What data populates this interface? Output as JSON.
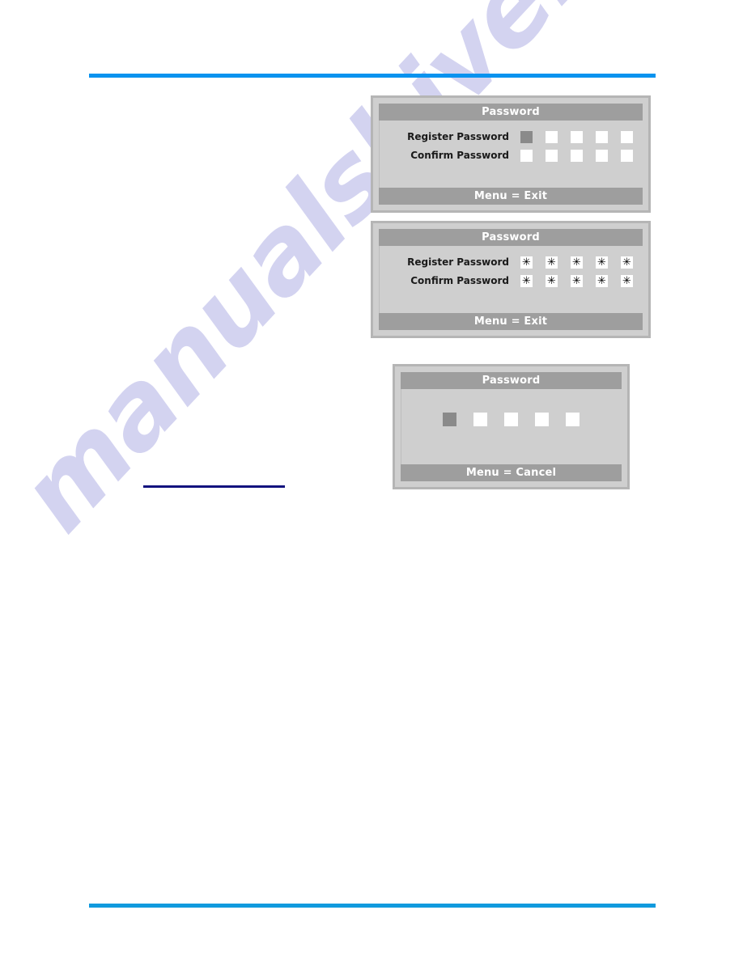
{
  "page": {
    "background": "#ffffff",
    "rule_color_top": "#0a93ef",
    "rule_color_bottom": "#119ade",
    "nav_underline_color": "#12127e"
  },
  "watermark": {
    "text": "manualshive.com",
    "color": "#b9b9e8"
  },
  "osd_common": {
    "title": "Password",
    "title_bar_color": "#9e9e9e",
    "body_color": "#cfcfcf",
    "border_color": "#b5b5b5",
    "box_empty_color": "#ffffff",
    "box_filled_color": "#8a8a8a",
    "mask_glyph": "✳"
  },
  "dialogs": [
    {
      "id": "password-register-empty",
      "title": "Password",
      "footer": "Menu = Exit",
      "rows": [
        {
          "label": "Register Password",
          "boxes": [
            {
              "filled": true,
              "glyph": ""
            },
            {
              "filled": false,
              "glyph": ""
            },
            {
              "filled": false,
              "glyph": ""
            },
            {
              "filled": false,
              "glyph": ""
            },
            {
              "filled": false,
              "glyph": ""
            }
          ]
        },
        {
          "label": "Confirm Password",
          "boxes": [
            {
              "filled": false,
              "glyph": ""
            },
            {
              "filled": false,
              "glyph": ""
            },
            {
              "filled": false,
              "glyph": ""
            },
            {
              "filled": false,
              "glyph": ""
            },
            {
              "filled": false,
              "glyph": ""
            }
          ]
        }
      ]
    },
    {
      "id": "password-register-filled",
      "title": "Password",
      "footer": "Menu = Exit",
      "rows": [
        {
          "label": "Register Password",
          "boxes": [
            {
              "filled": false,
              "glyph": "✳"
            },
            {
              "filled": false,
              "glyph": "✳"
            },
            {
              "filled": false,
              "glyph": "✳"
            },
            {
              "filled": false,
              "glyph": "✳"
            },
            {
              "filled": false,
              "glyph": "✳"
            }
          ]
        },
        {
          "label": "Confirm Password",
          "boxes": [
            {
              "filled": false,
              "glyph": "✳"
            },
            {
              "filled": false,
              "glyph": "✳"
            },
            {
              "filled": false,
              "glyph": "✳"
            },
            {
              "filled": false,
              "glyph": "✳"
            },
            {
              "filled": false,
              "glyph": "✳"
            }
          ]
        }
      ]
    },
    {
      "id": "password-entry",
      "title": "Password",
      "footer": "Menu = Cancel",
      "rows": [
        {
          "label": "",
          "boxes": [
            {
              "filled": true,
              "glyph": ""
            },
            {
              "filled": false,
              "glyph": ""
            },
            {
              "filled": false,
              "glyph": ""
            },
            {
              "filled": false,
              "glyph": ""
            },
            {
              "filled": false,
              "glyph": ""
            }
          ]
        }
      ]
    }
  ]
}
